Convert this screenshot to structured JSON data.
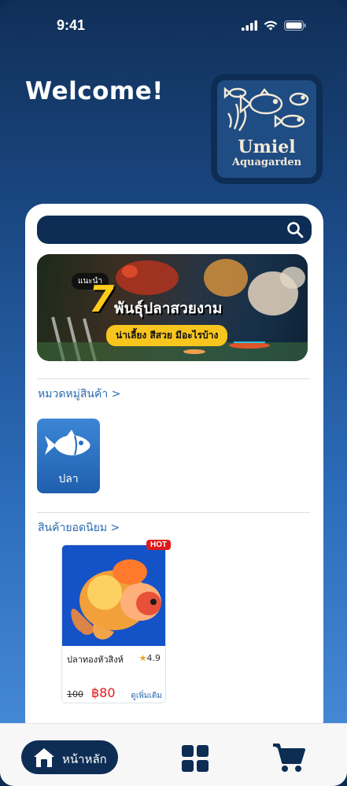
{
  "status_bar": {
    "time": "9:41"
  },
  "header": {
    "welcome": "Welcome!",
    "logo_name": "Umiel",
    "logo_sub": "Aquagarden"
  },
  "search": {
    "placeholder": ""
  },
  "banner": {
    "tag": "แนะนำ",
    "number": "7",
    "title": "พันธุ์ปลาสวยงาม",
    "subtitle": "น่าเลี้ยง สีสวย มีอะไรบ้าง"
  },
  "categories": {
    "title": "หมวดหมู่สินค้า >",
    "items": [
      {
        "label": "ปลา"
      }
    ]
  },
  "popular": {
    "title": "สินค้ายอดนิยม >",
    "products": [
      {
        "badge": "HOT",
        "name": "ปลาทองหัวสิงห์",
        "rating": "4.9",
        "old_price": "100",
        "price": "฿80",
        "more": "ดูเพิ่มเติม"
      }
    ]
  },
  "bottom_nav": {
    "home_label": "หน้าหลัก"
  },
  "colors": {
    "navy": "#0d2d55",
    "accent_blue": "#2b6cb0",
    "price_red": "#e01a1a",
    "hot_red": "#e01a1a"
  }
}
